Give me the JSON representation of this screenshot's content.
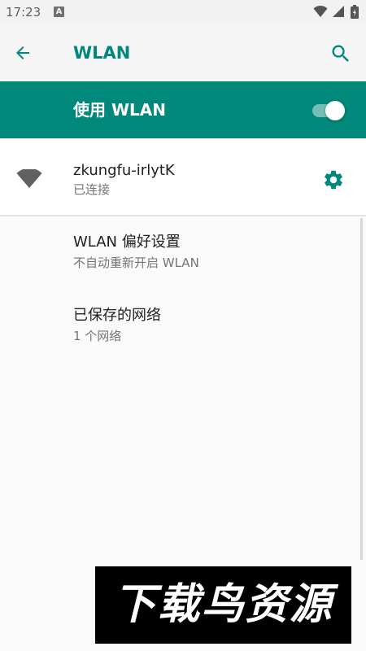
{
  "status_bar": {
    "time": "17:23",
    "notification_icon": "A"
  },
  "app_bar": {
    "title": "WLAN"
  },
  "master_switch": {
    "label": "使用 WLAN",
    "enabled": true
  },
  "connected_network": {
    "ssid": "zkungfu-irlytK",
    "status": "已连接"
  },
  "preferences": [
    {
      "title": "WLAN 偏好设置",
      "summary": "不自动重新开启 WLAN"
    },
    {
      "title": "已保存的网络",
      "summary": "1 个网络"
    }
  ],
  "watermark": {
    "text": "下载鸟资源"
  },
  "colors": {
    "accent": "#00897b",
    "title": "#00867a",
    "background": "#fafafa"
  },
  "icons": {
    "back": "arrow-left-icon",
    "search": "search-icon",
    "wifi_signal": "wifi-signal-icon",
    "network_settings": "gear-icon"
  }
}
